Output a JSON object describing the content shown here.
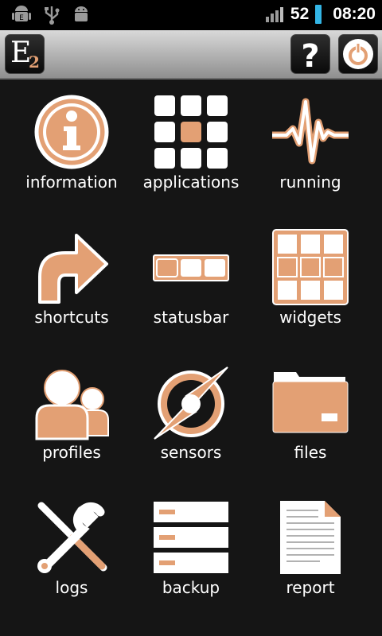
{
  "status": {
    "battery_level": "52",
    "time": "08:20"
  },
  "appbar": {
    "logo_text": "E",
    "logo_sub": "2"
  },
  "tiles": [
    {
      "label": "information"
    },
    {
      "label": "applications"
    },
    {
      "label": "running"
    },
    {
      "label": "shortcuts"
    },
    {
      "label": "statusbar"
    },
    {
      "label": "widgets"
    },
    {
      "label": "profiles"
    },
    {
      "label": "sensors"
    },
    {
      "label": "files"
    },
    {
      "label": "logs"
    },
    {
      "label": "backup"
    },
    {
      "label": "report"
    }
  ],
  "colors": {
    "accent": "#e3a074",
    "background": "#151515"
  }
}
